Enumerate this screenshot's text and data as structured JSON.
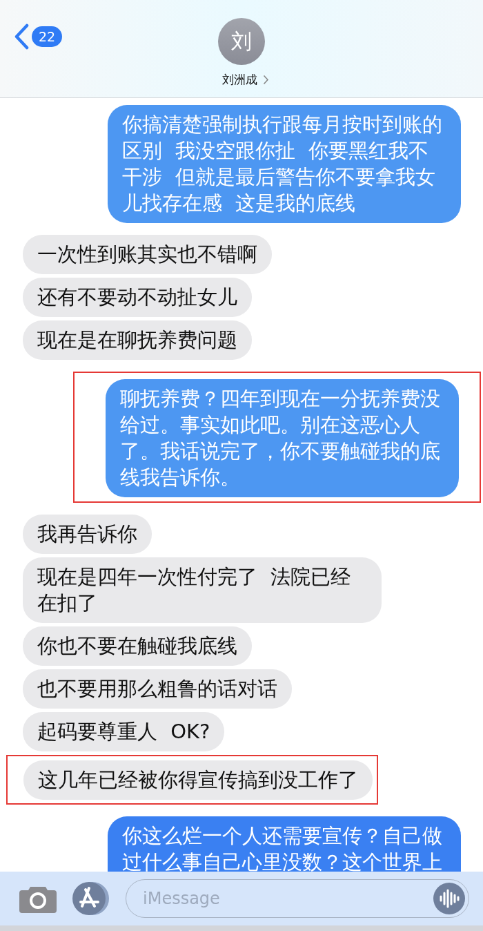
{
  "header": {
    "back_badge": "22",
    "avatar_initial": "刘",
    "contact_name": "刘洲成"
  },
  "messages": [
    {
      "kind": "sent",
      "text": "你搞清楚强制执行跟每月按时到账的区别 我没空跟你扯 你要黑红我不干涉 但就是最后警告你不要拿我女儿找存在感 这是我的底线",
      "highlighted": false
    },
    {
      "kind": "received",
      "text": "一次性到账其实也不错啊",
      "highlighted": false
    },
    {
      "kind": "received",
      "text": "还有不要动不动扯女儿",
      "highlighted": false
    },
    {
      "kind": "received",
      "text": "现在是在聊抚养费问题",
      "highlighted": false
    },
    {
      "kind": "sent",
      "text": "聊抚养费？四年到现在一分抚养费没给过。事实如此吧。别在这恶心人了。我话说完了，你不要触碰我的底线我告诉你。",
      "highlighted": true
    },
    {
      "kind": "received",
      "text": "我再告诉你",
      "highlighted": false
    },
    {
      "kind": "received",
      "text": "现在是四年一次性付完了 法院已经在扣了",
      "highlighted": false
    },
    {
      "kind": "received",
      "text": "你也不要在触碰我底线",
      "highlighted": false
    },
    {
      "kind": "received",
      "text": "也不要用那么粗鲁的话对话",
      "highlighted": false
    },
    {
      "kind": "received",
      "text": "起码要尊重人 OK?",
      "highlighted": false
    },
    {
      "kind": "received",
      "text": "这几年已经被你得宣传搞到没工作了",
      "highlighted": true
    },
    {
      "kind": "sent",
      "text": "你这么烂一个人还需要宣传？自己做过什么事自己心里没数？这个世界上",
      "highlighted": false
    }
  ],
  "composer": {
    "placeholder": "iMessage"
  }
}
